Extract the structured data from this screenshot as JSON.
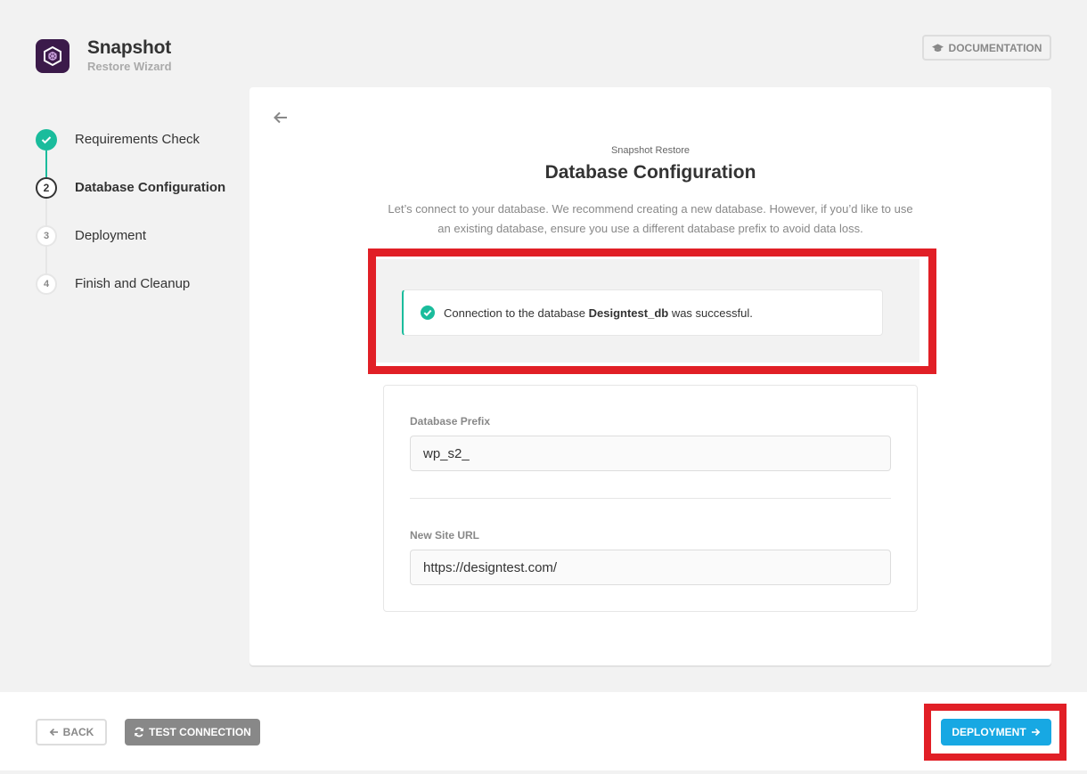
{
  "header": {
    "app_title": "Snapshot",
    "app_subtitle": "Restore Wizard",
    "documentation_label": "DOCUMENTATION"
  },
  "steps": [
    {
      "number": "1",
      "label": "Requirements Check",
      "state": "done"
    },
    {
      "number": "2",
      "label": "Database Configuration",
      "state": "current"
    },
    {
      "number": "3",
      "label": "Deployment",
      "state": "pending"
    },
    {
      "number": "4",
      "label": "Finish and Cleanup",
      "state": "pending"
    }
  ],
  "main": {
    "eyebrow": "Snapshot Restore",
    "title": "Database Configuration",
    "description": "Let’s connect to your database. We recommend creating a new database. However, if you’d like to use an existing database, ensure you use a different database prefix to avoid data loss.",
    "notice": {
      "prefix": "Connection to the database ",
      "db_name": "Designtest_db",
      "suffix": " was successful."
    },
    "fields": {
      "db_prefix_label": "Database Prefix",
      "db_prefix_value": "wp_s2_",
      "site_url_label": "New Site URL",
      "site_url_value": "https://designtest.com/"
    }
  },
  "footer": {
    "back_label": "BACK",
    "test_connection_label": "TEST CONNECTION",
    "deployment_label": "DEPLOYMENT"
  },
  "colors": {
    "success": "#1abc9c",
    "primary": "#17a8e3",
    "highlight": "#e11f26",
    "logo_bg": "#3b1a4a"
  },
  "icons": {
    "logo": "snapshot-logo-icon",
    "documentation": "graduation-cap-icon",
    "back_arrow": "arrow-left-icon",
    "notice": "check-circle-icon",
    "test_connection": "refresh-icon",
    "deployment": "arrow-right-icon"
  }
}
